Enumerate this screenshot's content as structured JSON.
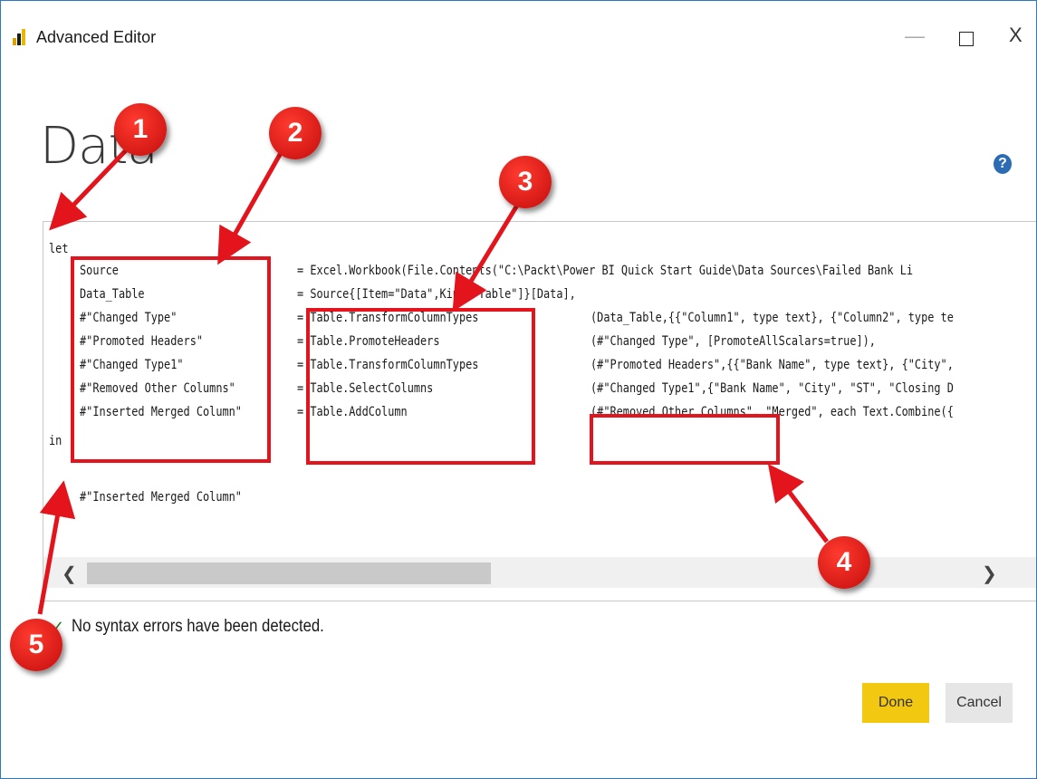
{
  "window": {
    "title": "Advanced Editor",
    "minimize_glyph": "—",
    "close_glyph": "X"
  },
  "heading": "Data",
  "help_icon": "?",
  "code": {
    "let_keyword": "let",
    "in_keyword": "in",
    "steps": [
      {
        "name": "Source",
        "func": "= Excel.Workbook(File.Contents(\"C:\\Packt\\Power BI Quick Start Guide\\Data Sources\\Failed Bank Li",
        "args": ""
      },
      {
        "name": "Data_Table",
        "func": "= Source{[Item=\"Data\",Kind=\"Table\"]}[Data],",
        "args": ""
      },
      {
        "name": "#\"Changed Type\"",
        "func": "= Table.TransformColumnTypes",
        "args": "(Data_Table,{{\"Column1\", type text}, {\"Column2\", type te"
      },
      {
        "name": "#\"Promoted Headers\"",
        "func": "= Table.PromoteHeaders",
        "args": "(#\"Changed Type\", [PromoteAllScalars=true]),"
      },
      {
        "name": "#\"Changed Type1\"",
        "func": "= Table.TransformColumnTypes",
        "args": "(#\"Promoted Headers\",{{\"Bank Name\", type text}, {\"City\","
      },
      {
        "name": "#\"Removed Other Columns\"",
        "func": "= Table.SelectColumns",
        "args": "(#\"Changed Type1\",{\"Bank Name\", \"City\", \"ST\", \"Closing D"
      },
      {
        "name": "#\"Inserted Merged Column\"",
        "func": "= Table.AddColumn",
        "args": "(#\"Removed Other Columns\", \"Merged\", each Text.Combine({"
      }
    ],
    "result": "#\"Inserted Merged Column\""
  },
  "scrollbar": {
    "left_glyph": "❮",
    "right_glyph": "❯"
  },
  "status": {
    "check_glyph": "✓",
    "text": "No syntax errors have been detected."
  },
  "buttons": {
    "done": "Done",
    "cancel": "Cancel"
  },
  "callouts": [
    "1",
    "2",
    "3",
    "4",
    "5"
  ],
  "colors": {
    "accent_yellow": "#f2c811",
    "annotation_red": "#e3141b",
    "help_blue": "#2b6cb5"
  }
}
